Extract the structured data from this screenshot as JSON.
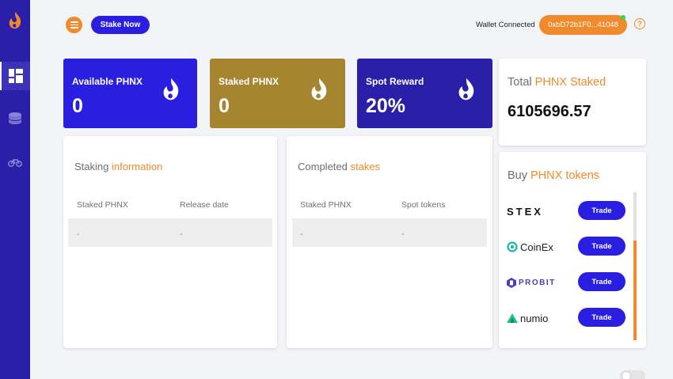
{
  "header": {
    "menu_icon": "hamburger-icon",
    "stake_now_label": "Stake Now",
    "wallet_label": "Wallet Connected",
    "wallet_address": "0xbD72b1F0...41048",
    "help_glyph": "?"
  },
  "sidebar": {
    "logo_icon": "phoenix-flame-logo",
    "items": [
      {
        "icon": "dashboard-icon",
        "active": true
      },
      {
        "icon": "coins-stack-icon",
        "active": false
      },
      {
        "icon": "bicycle-icon",
        "active": false
      }
    ]
  },
  "stats": [
    {
      "label": "Available PHNX",
      "value": "0",
      "color": "#2a1fe0"
    },
    {
      "label": "Staked PHNX",
      "value": "0",
      "color": "#a68530"
    },
    {
      "label": "Spot Reward",
      "value": "20%",
      "color": "#2a1fa8"
    }
  ],
  "total": {
    "title_prefix": "Total ",
    "title_accent": "PHNX Staked",
    "value": "6105696.57"
  },
  "staking_info": {
    "title_prefix": "Staking ",
    "title_accent": "information",
    "columns": [
      "Staked PHNX",
      "Release date"
    ],
    "rows": [
      [
        "-",
        "-"
      ]
    ]
  },
  "completed": {
    "title_prefix": "Completed ",
    "title_accent": "stakes",
    "columns": [
      "Staked PHNX",
      "Spot tokens"
    ],
    "rows": [
      [
        "-",
        "-"
      ]
    ]
  },
  "buy": {
    "title_prefix": "Buy ",
    "title_accent": "PHNX tokens",
    "exchanges": [
      {
        "name": "STEX",
        "icon": "stex-logo",
        "trade_label": "Trade"
      },
      {
        "name": "CoinEx",
        "icon": "coinex-logo",
        "trade_label": "Trade"
      },
      {
        "name": "PROBIT",
        "icon": "probit-logo",
        "trade_label": "Trade"
      },
      {
        "name": "numio",
        "icon": "numio-logo",
        "trade_label": "Trade"
      }
    ]
  },
  "colors": {
    "accent": "#ef8b2c",
    "primary": "#2a1fe0",
    "sidebar": "#2a1fa8",
    "wallet_status": "#2bd85a"
  }
}
